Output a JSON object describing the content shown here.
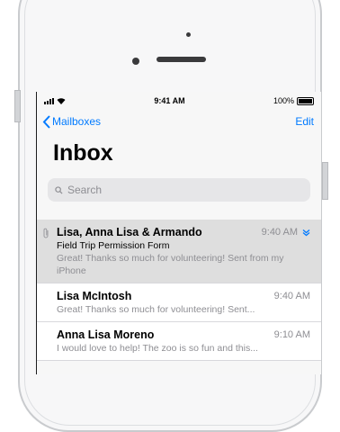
{
  "status": {
    "time": "9:41 AM",
    "battery": "100%"
  },
  "nav": {
    "back_label": "Mailboxes",
    "edit_label": "Edit"
  },
  "title": "Inbox",
  "search": {
    "placeholder": "Search"
  },
  "emails": [
    {
      "sender": "Lisa, Anna Lisa & Armando",
      "time": "9:40 AM",
      "subject": "Field Trip Permission Form",
      "preview": "Great! Thanks so much for volunteering! Sent from my iPhone",
      "has_attachment": true,
      "selected": true
    },
    {
      "sender": "Lisa McIntosh",
      "time": "9:40 AM",
      "subject": "",
      "preview": "Great! Thanks so much for volunteering! Sent..."
    },
    {
      "sender": "Anna Lisa Moreno",
      "time": "9:10 AM",
      "subject": "",
      "preview": "I would love to help! The zoo is so fun and this..."
    }
  ],
  "colors": {
    "accent": "#007aff"
  },
  "icons": [
    "signal-icon",
    "wifi-icon",
    "battery-icon",
    "chevron-left-icon",
    "search-icon",
    "paperclip-icon",
    "chevron-down-icon"
  ]
}
